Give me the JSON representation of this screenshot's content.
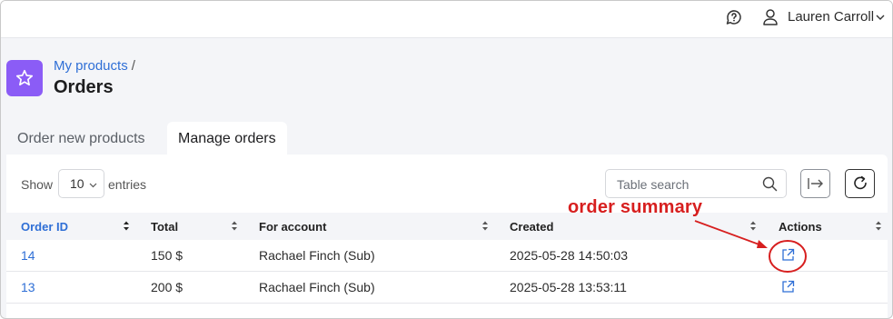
{
  "topbar": {
    "user_name": "Lauren Carroll",
    "icons": [
      "help-icon",
      "user-icon",
      "chevron-down-icon"
    ]
  },
  "breadcrumb": {
    "parent": "My products",
    "separator": "/"
  },
  "page": {
    "title": "Orders",
    "icon": "star-icon",
    "accent_color": "#8b5cf6"
  },
  "tabs": [
    {
      "label": "Order new products",
      "active": false
    },
    {
      "label": "Manage orders",
      "active": true
    }
  ],
  "controls": {
    "show_label": "Show",
    "entries_value": "10",
    "entries_label": "entries",
    "search_placeholder": "Table search"
  },
  "table": {
    "columns": [
      "Order ID",
      "Total",
      "For account",
      "Created",
      "Actions"
    ],
    "rows": [
      {
        "order_id": "14",
        "total": "150 $",
        "account": "Rachael Finch (Sub)",
        "created": "2025-05-28 14:50:03"
      },
      {
        "order_id": "13",
        "total": "200 $",
        "account": "Rachael Finch (Sub)",
        "created": "2025-05-28 13:53:11"
      }
    ]
  },
  "annotation": {
    "text": "order summary",
    "color": "#d71f1f"
  },
  "colors": {
    "link": "#2f6fd6",
    "background": "#f4f5f8"
  }
}
